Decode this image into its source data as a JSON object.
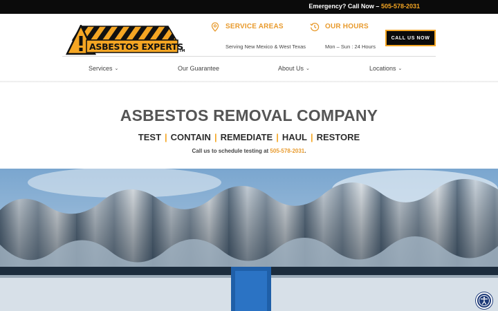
{
  "topbar": {
    "emergency_label": "Emergency? Call Now – ",
    "emergency_phone": "505-578-2031"
  },
  "header": {
    "logo_text": "ASBESTOS EXPERTS",
    "logo_tm": "TM",
    "service_areas": {
      "title": "SERVICE AREAS",
      "subtitle": "Serving New Mexico & West Texas",
      "icon": "location-pin-icon"
    },
    "hours": {
      "title": "OUR HOURS",
      "subtitle": "Mon – Sun : 24 Hours",
      "icon": "clock-history-icon"
    },
    "call_button": "CALL US NOW"
  },
  "nav": {
    "items": [
      {
        "label": "Services",
        "has_dropdown": true
      },
      {
        "label": "Our Guarantee",
        "has_dropdown": false
      },
      {
        "label": "About Us",
        "has_dropdown": true
      },
      {
        "label": "Locations",
        "has_dropdown": true
      }
    ]
  },
  "hero": {
    "title": "ASBESTOS REMOVAL COMPANY",
    "steps": [
      "TEST",
      "CONTAIN",
      "REMEDIATE",
      "HAUL",
      "RESTORE"
    ],
    "separator": "|",
    "call_prefix": "Call us to schedule testing at ",
    "call_phone": "505-578-2031",
    "call_suffix": "."
  },
  "colors": {
    "accent": "#f5a623",
    "accent_text": "#e89a2c",
    "dark": "#0b0b0b",
    "a11y_button": "#1d3a78"
  }
}
